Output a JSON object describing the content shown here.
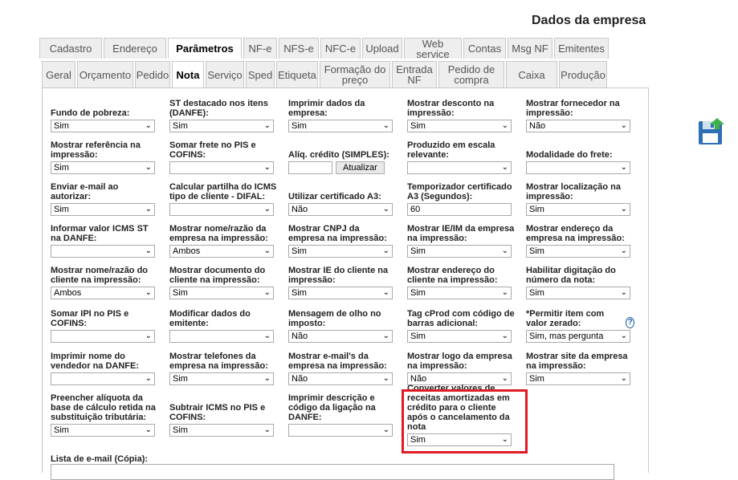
{
  "page": {
    "title": "Dados da empresa"
  },
  "tabs_main": [
    "Cadastro",
    "Endereço",
    "Parâmetros",
    "NF-e",
    "NFS-e",
    "NFC-e",
    "Upload",
    "Web service",
    "Contas",
    "Msg NF",
    "Emitentes"
  ],
  "tabs_sub": [
    "Geral",
    "Orçamento",
    "Pedido",
    "Nota",
    "Serviço",
    "Sped",
    "Etiqueta",
    "Formação do preço",
    "Entrada NF",
    "Pedido de compra",
    "Caixa",
    "Produção"
  ],
  "fields": [
    {
      "label": "Fundo de pobreza:",
      "value": "Sim"
    },
    {
      "label": "ST destacado nos itens (DANFE):",
      "value": "Sim"
    },
    {
      "label": "Imprimir dados da empresa:",
      "value": "Sim"
    },
    {
      "label": "Mostrar desconto na impressão:",
      "value": "Sim"
    },
    {
      "label": "Mostrar fornecedor na impressão:",
      "value": "Não"
    },
    {
      "label": "Mostrar referência na impressão:",
      "value": "Sim"
    },
    {
      "label": "Somar frete no PIS e COFINS:",
      "value": ""
    },
    {
      "label": "Alíq. crédito (SIMPLES):",
      "value": "",
      "button": "Atualizar"
    },
    {
      "label": "Produzido em escala relevante:",
      "value": ""
    },
    {
      "label": "Modalidade do frete:",
      "value": ""
    },
    {
      "label": "Enviar e-mail ao autorizar:",
      "value": "Sim"
    },
    {
      "label": "Calcular partilha do ICMS tipo de cliente - DIFAL:",
      "value": ""
    },
    {
      "label": "Utilizar certificado A3:",
      "value": "Não"
    },
    {
      "label": "Temporizador certificado A3 (Segundos):",
      "value": "60",
      "kind": "text"
    },
    {
      "label": "Mostrar localização na impressão:",
      "value": "Sim"
    },
    {
      "label": "Informar valor ICMS ST na DANFE:",
      "value": ""
    },
    {
      "label": "Mostrar nome/razão da empresa na impressão:",
      "value": "Ambos"
    },
    {
      "label": "Mostrar CNPJ da empresa na impressão:",
      "value": "Sim"
    },
    {
      "label": "Mostrar IE/IM da empresa na impressão:",
      "value": "Sim"
    },
    {
      "label": "Mostrar endereço da empresa na impressão:",
      "value": "Sim"
    },
    {
      "label": "Mostrar nome/razão do cliente na impressão:",
      "value": "Ambos"
    },
    {
      "label": "Mostrar documento do cliente na impressão:",
      "value": "Sim"
    },
    {
      "label": "Mostrar IE do cliente na impressão:",
      "value": "Sim"
    },
    {
      "label": "Mostrar endereço do cliente na impressão:",
      "value": "Sim"
    },
    {
      "label": "Habilitar digitação do número da nota:",
      "value": "Sim"
    },
    {
      "label": "Somar IPI no PIS e COFINS:",
      "value": ""
    },
    {
      "label": "Modificar dados do emitente:",
      "value": ""
    },
    {
      "label": "Mensagem de olho no imposto:",
      "value": "Não"
    },
    {
      "label": "Tag cProd com código de barras adicional:",
      "value": "Sim"
    },
    {
      "label": "*Permitir item com valor zerado:",
      "value": "Sim, mas pergunta",
      "help": true
    },
    {
      "label": "Imprimir nome do vendedor na DANFE:",
      "value": ""
    },
    {
      "label": "Mostrar telefones da empresa na impressão:",
      "value": "Sim"
    },
    {
      "label": "Mostrar e-mail's da empresa na impressão:",
      "value": "Não"
    },
    {
      "label": "Mostrar logo da empresa na impressão:",
      "value": "Não"
    },
    {
      "label": "Mostrar site da empresa na impressão:",
      "value": "Sim"
    },
    {
      "label": "Preencher alíquota da base de cálculo retida na substituição tributária:",
      "value": "Sim"
    },
    {
      "label": "Subtrair ICMS no PIS e COFINS:",
      "value": "Sim"
    },
    {
      "label": "Imprimir descrição e código da ligação na DANFE:",
      "value": ""
    },
    {
      "label": "Converter valores de receitas amortizadas em crédito para o cliente após o cancelamento da nota",
      "value": "Sim"
    }
  ],
  "email_label": "Lista de e-mail (Cópia):",
  "icons": {
    "save": "save-icon",
    "help": "help-icon",
    "dropdown": "chevron-down-icon"
  },
  "colors": {
    "highlight": "#e01b24"
  }
}
